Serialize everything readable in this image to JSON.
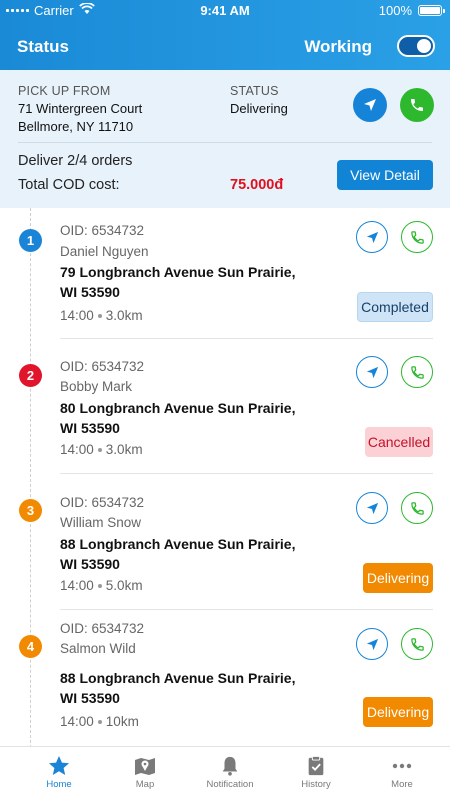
{
  "status_bar": {
    "carrier": "Carrier",
    "time": "9:41 AM",
    "battery": "100%"
  },
  "header": {
    "title": "Status",
    "working_label": "Working",
    "working_on": true
  },
  "summary": {
    "pickup_label": "PICK UP FROM",
    "pickup_line1": "71 Wintergreen Court",
    "pickup_line2": "Bellmore, NY 11710",
    "status_label": "STATUS",
    "status_value": "Delivering",
    "deliver_text": "Deliver 2/4 orders",
    "cod_label": "Total COD cost:",
    "cod_value": "75.000đ",
    "view_detail": "View Detail"
  },
  "orders": [
    {
      "num": "1",
      "num_color": "#1a84d6",
      "oid": "OID: 6534732",
      "name": "Daniel Nguyen",
      "addr1": "79 Longbranch Avenue Sun Prairie,",
      "addr2": "WI 53590",
      "time": "14:00",
      "dist": "3.0km",
      "status": "Completed"
    },
    {
      "num": "2",
      "num_color": "#e0142a",
      "oid": "OID: 6534732",
      "name": "Bobby Mark",
      "addr1": "80 Longbranch Avenue Sun Prairie,",
      "addr2": "WI 53590",
      "time": "14:00",
      "dist": "3.0km",
      "status": "Cancelled"
    },
    {
      "num": "3",
      "num_color": "#f18a00",
      "oid": "OID: 6534732",
      "name": "William Snow",
      "addr1": "88 Longbranch Avenue Sun Prairie,",
      "addr2": "WI 53590",
      "time": "14:00",
      "dist": "5.0km",
      "status": "Delivering"
    },
    {
      "num": "4",
      "num_color": "#f18a00",
      "oid": "OID: 6534732",
      "name": "Salmon Wild",
      "addr1": "88 Longbranch Avenue Sun Prairie,",
      "addr2": "WI 53590",
      "time": "14:00",
      "dist": "10km",
      "status": "Delivering"
    }
  ],
  "tabs": [
    {
      "label": "Home",
      "icon": "star-icon",
      "active": true
    },
    {
      "label": "Map",
      "icon": "map-icon",
      "active": false
    },
    {
      "label": "Notification",
      "icon": "bell-icon",
      "active": false
    },
    {
      "label": "History",
      "icon": "clipboard-icon",
      "active": false
    },
    {
      "label": "More",
      "icon": "more-icon",
      "active": false
    }
  ],
  "colors": {
    "primary": "#1a84d6",
    "call_green": "#2eb82e",
    "cancel_red": "#e0142a",
    "delivering_orange": "#f18a00"
  }
}
